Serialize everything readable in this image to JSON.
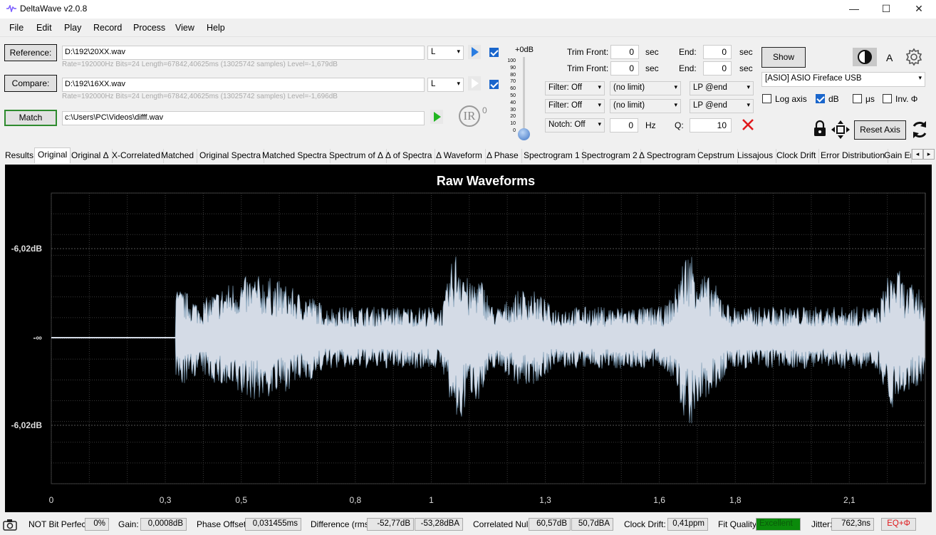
{
  "window": {
    "title": "DeltaWave v2.0.8",
    "minimize": "—",
    "maximize": "☐",
    "close": "✕"
  },
  "menu": [
    "File",
    "Edit",
    "Play",
    "Record",
    "Process",
    "View",
    "Help"
  ],
  "reference": {
    "button": "Reference:",
    "path": "D:\\192\\20XX.wav",
    "meta": "Rate=192000Hz Bits=24 Length=67842,40625ms (13025742 samples) Level=-1,679dB",
    "channel": "L"
  },
  "compare": {
    "button": "Compare:",
    "path": "D:\\192\\16XX.wav",
    "meta": "Rate=192000Hz Bits=24 Length=67842,40625ms (13025742 samples) Level=-1,696dB",
    "channel": "L"
  },
  "match": {
    "button": "Match",
    "path": "c:\\Users\\PC\\Videos\\difff.wav"
  },
  "ir": {
    "label": "IR",
    "superscript": "0"
  },
  "volume": {
    "label": "+0dB",
    "ticks": [
      "100",
      "90",
      "80",
      "70",
      "60",
      "50",
      "40",
      "30",
      "20",
      "10",
      "0"
    ],
    "level": 0
  },
  "trim": {
    "front_label": "Trim Front:",
    "end_label": "End:",
    "unit": "sec",
    "row1": {
      "front": "0",
      "end": "0"
    },
    "row2": {
      "front": "0",
      "end": "0"
    }
  },
  "filters": {
    "row1": {
      "filter": "Filter: Off",
      "limit": "(no limit)",
      "lp": "LP @end"
    },
    "row2": {
      "filter": "Filter: Off",
      "limit": "(no limit)",
      "lp": "LP @end"
    },
    "notch": {
      "label": "Notch: Off",
      "hz_value": "0",
      "hz_unit": "Hz",
      "q_label": "Q:",
      "q_value": "10"
    }
  },
  "right_panel": {
    "show": "Show",
    "a_label": "A",
    "device": "[ASIO] ASIO Fireface USB",
    "options": [
      {
        "label": "Log axis",
        "checked": false
      },
      {
        "label": "dB",
        "checked": true
      },
      {
        "label": "μs",
        "checked": false
      },
      {
        "label": "Inv. Φ",
        "checked": false
      }
    ],
    "reset_axis": "Reset Axis"
  },
  "tabs": [
    "Results",
    "Original",
    "Original Δ",
    "X-Correlated",
    "Matched",
    "Original Spectra",
    "Matched Spectra",
    "Spectrum of Δ",
    "Δ of Spectra",
    "Δ Waveform",
    "Δ Phase",
    "Spectrogram 1",
    "Spectrogram 2",
    "Δ Spectrogram",
    "Cepstrum",
    "Lissajous",
    "Clock Drift",
    "Error Distribution",
    "Gain Err"
  ],
  "active_tab": "Original",
  "chart_data": {
    "type": "line",
    "title": "Raw Waveforms",
    "xlabel": "",
    "ylabel": "",
    "xlim": [
      0,
      2.3
    ],
    "y_tick_labels": [
      "-6,02dB",
      "-∞",
      "-6,02dB"
    ],
    "x": [
      0,
      0.3,
      0.5,
      0.8,
      1,
      1.3,
      1.6,
      1.8,
      2.1
    ],
    "x_tick_labels": [
      "0",
      "0,3",
      "0,5",
      "0,8",
      "1",
      "1,3",
      "1,6",
      "1,8",
      "2,1"
    ],
    "grid": true,
    "series": [
      {
        "name": "",
        "color": "#d4dbe6",
        "edge_color": "#7a9bb5"
      }
    ]
  },
  "status": {
    "bit_perfect": "NOT Bit Perfect",
    "bit_pct": "0%",
    "gain_label": "Gain:",
    "gain": "0,0008dB",
    "phase_label": "Phase Offset:",
    "phase": "0,031455ms",
    "diff_label": "Difference (rms):",
    "diff1": "-52,77dB",
    "diff2": "-53,28dBA",
    "null_label": "Correlated Null:",
    "null1": "60,57dB",
    "null2": "50,7dBA",
    "drift_label": "Clock Drift:",
    "drift": "0,41ppm",
    "fit_label": "Fit Quality:",
    "fit": "Excellent",
    "jitter_label": "Jitter:",
    "jitter": "762,3ns",
    "eq": "EQ+Φ"
  }
}
